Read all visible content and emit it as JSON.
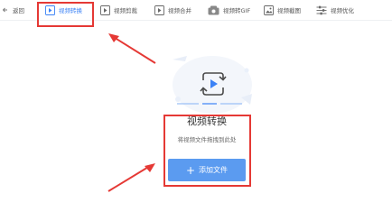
{
  "toolbar": {
    "back_label": "返回",
    "items": [
      {
        "label": "视频转换",
        "icon": "convert-icon"
      },
      {
        "label": "视频剪裁",
        "icon": "crop-icon"
      },
      {
        "label": "视频合并",
        "icon": "merge-icon"
      },
      {
        "label": "视频转GIF",
        "icon": "gif-icon"
      },
      {
        "label": "视频截图",
        "icon": "screenshot-icon"
      },
      {
        "label": "视频优化",
        "icon": "optimize-icon"
      }
    ],
    "active_index": 0
  },
  "main": {
    "title": "视频转换",
    "hint": "将视频文件拖拽到此处",
    "add_button_label": "添加文件",
    "add_button_icon": "plus-icon"
  },
  "colors": {
    "accent": "#3b82f6",
    "button": "#5b9bf0",
    "annotation_red": "#e53935"
  }
}
